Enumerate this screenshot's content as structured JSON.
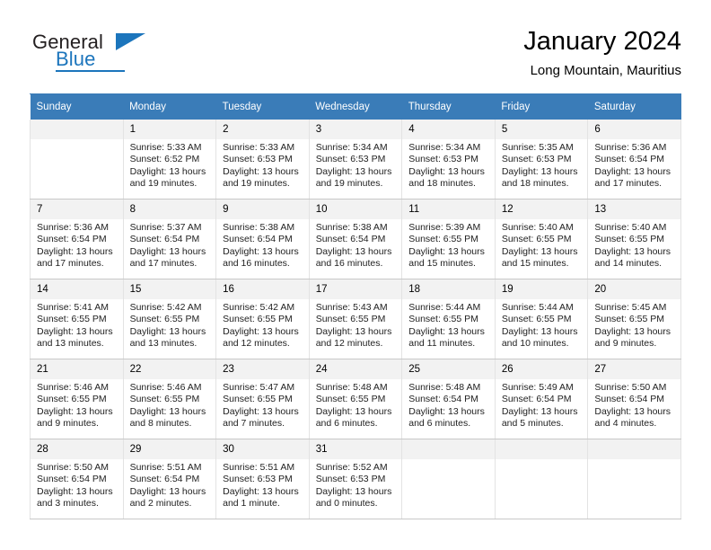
{
  "brand": {
    "name_part1": "General",
    "name_part2": "Blue",
    "logo_icon": "triangle-icon"
  },
  "header": {
    "title": "January 2024",
    "subtitle": "Long Mountain, Mauritius"
  },
  "colors": {
    "header_row_bg": "#3a7cb8",
    "daynum_bg": "#f2f2f2",
    "brand_blue": "#1c75bc",
    "grid_line": "#c8c8c8"
  },
  "calendar": {
    "weekday_headers": [
      "Sunday",
      "Monday",
      "Tuesday",
      "Wednesday",
      "Thursday",
      "Friday",
      "Saturday"
    ],
    "weeks": [
      [
        {
          "day": "",
          "lines": []
        },
        {
          "day": "1",
          "lines": [
            "Sunrise: 5:33 AM",
            "Sunset: 6:52 PM",
            "Daylight: 13 hours",
            "and 19 minutes."
          ]
        },
        {
          "day": "2",
          "lines": [
            "Sunrise: 5:33 AM",
            "Sunset: 6:53 PM",
            "Daylight: 13 hours",
            "and 19 minutes."
          ]
        },
        {
          "day": "3",
          "lines": [
            "Sunrise: 5:34 AM",
            "Sunset: 6:53 PM",
            "Daylight: 13 hours",
            "and 19 minutes."
          ]
        },
        {
          "day": "4",
          "lines": [
            "Sunrise: 5:34 AM",
            "Sunset: 6:53 PM",
            "Daylight: 13 hours",
            "and 18 minutes."
          ]
        },
        {
          "day": "5",
          "lines": [
            "Sunrise: 5:35 AM",
            "Sunset: 6:53 PM",
            "Daylight: 13 hours",
            "and 18 minutes."
          ]
        },
        {
          "day": "6",
          "lines": [
            "Sunrise: 5:36 AM",
            "Sunset: 6:54 PM",
            "Daylight: 13 hours",
            "and 17 minutes."
          ]
        }
      ],
      [
        {
          "day": "7",
          "lines": [
            "Sunrise: 5:36 AM",
            "Sunset: 6:54 PM",
            "Daylight: 13 hours",
            "and 17 minutes."
          ]
        },
        {
          "day": "8",
          "lines": [
            "Sunrise: 5:37 AM",
            "Sunset: 6:54 PM",
            "Daylight: 13 hours",
            "and 17 minutes."
          ]
        },
        {
          "day": "9",
          "lines": [
            "Sunrise: 5:38 AM",
            "Sunset: 6:54 PM",
            "Daylight: 13 hours",
            "and 16 minutes."
          ]
        },
        {
          "day": "10",
          "lines": [
            "Sunrise: 5:38 AM",
            "Sunset: 6:54 PM",
            "Daylight: 13 hours",
            "and 16 minutes."
          ]
        },
        {
          "day": "11",
          "lines": [
            "Sunrise: 5:39 AM",
            "Sunset: 6:55 PM",
            "Daylight: 13 hours",
            "and 15 minutes."
          ]
        },
        {
          "day": "12",
          "lines": [
            "Sunrise: 5:40 AM",
            "Sunset: 6:55 PM",
            "Daylight: 13 hours",
            "and 15 minutes."
          ]
        },
        {
          "day": "13",
          "lines": [
            "Sunrise: 5:40 AM",
            "Sunset: 6:55 PM",
            "Daylight: 13 hours",
            "and 14 minutes."
          ]
        }
      ],
      [
        {
          "day": "14",
          "lines": [
            "Sunrise: 5:41 AM",
            "Sunset: 6:55 PM",
            "Daylight: 13 hours",
            "and 13 minutes."
          ]
        },
        {
          "day": "15",
          "lines": [
            "Sunrise: 5:42 AM",
            "Sunset: 6:55 PM",
            "Daylight: 13 hours",
            "and 13 minutes."
          ]
        },
        {
          "day": "16",
          "lines": [
            "Sunrise: 5:42 AM",
            "Sunset: 6:55 PM",
            "Daylight: 13 hours",
            "and 12 minutes."
          ]
        },
        {
          "day": "17",
          "lines": [
            "Sunrise: 5:43 AM",
            "Sunset: 6:55 PM",
            "Daylight: 13 hours",
            "and 12 minutes."
          ]
        },
        {
          "day": "18",
          "lines": [
            "Sunrise: 5:44 AM",
            "Sunset: 6:55 PM",
            "Daylight: 13 hours",
            "and 11 minutes."
          ]
        },
        {
          "day": "19",
          "lines": [
            "Sunrise: 5:44 AM",
            "Sunset: 6:55 PM",
            "Daylight: 13 hours",
            "and 10 minutes."
          ]
        },
        {
          "day": "20",
          "lines": [
            "Sunrise: 5:45 AM",
            "Sunset: 6:55 PM",
            "Daylight: 13 hours",
            "and 9 minutes."
          ]
        }
      ],
      [
        {
          "day": "21",
          "lines": [
            "Sunrise: 5:46 AM",
            "Sunset: 6:55 PM",
            "Daylight: 13 hours",
            "and 9 minutes."
          ]
        },
        {
          "day": "22",
          "lines": [
            "Sunrise: 5:46 AM",
            "Sunset: 6:55 PM",
            "Daylight: 13 hours",
            "and 8 minutes."
          ]
        },
        {
          "day": "23",
          "lines": [
            "Sunrise: 5:47 AM",
            "Sunset: 6:55 PM",
            "Daylight: 13 hours",
            "and 7 minutes."
          ]
        },
        {
          "day": "24",
          "lines": [
            "Sunrise: 5:48 AM",
            "Sunset: 6:55 PM",
            "Daylight: 13 hours",
            "and 6 minutes."
          ]
        },
        {
          "day": "25",
          "lines": [
            "Sunrise: 5:48 AM",
            "Sunset: 6:54 PM",
            "Daylight: 13 hours",
            "and 6 minutes."
          ]
        },
        {
          "day": "26",
          "lines": [
            "Sunrise: 5:49 AM",
            "Sunset: 6:54 PM",
            "Daylight: 13 hours",
            "and 5 minutes."
          ]
        },
        {
          "day": "27",
          "lines": [
            "Sunrise: 5:50 AM",
            "Sunset: 6:54 PM",
            "Daylight: 13 hours",
            "and 4 minutes."
          ]
        }
      ],
      [
        {
          "day": "28",
          "lines": [
            "Sunrise: 5:50 AM",
            "Sunset: 6:54 PM",
            "Daylight: 13 hours",
            "and 3 minutes."
          ]
        },
        {
          "day": "29",
          "lines": [
            "Sunrise: 5:51 AM",
            "Sunset: 6:54 PM",
            "Daylight: 13 hours",
            "and 2 minutes."
          ]
        },
        {
          "day": "30",
          "lines": [
            "Sunrise: 5:51 AM",
            "Sunset: 6:53 PM",
            "Daylight: 13 hours",
            "and 1 minute."
          ]
        },
        {
          "day": "31",
          "lines": [
            "Sunrise: 5:52 AM",
            "Sunset: 6:53 PM",
            "Daylight: 13 hours",
            "and 0 minutes."
          ]
        },
        {
          "day": "",
          "lines": []
        },
        {
          "day": "",
          "lines": []
        },
        {
          "day": "",
          "lines": []
        }
      ]
    ]
  }
}
